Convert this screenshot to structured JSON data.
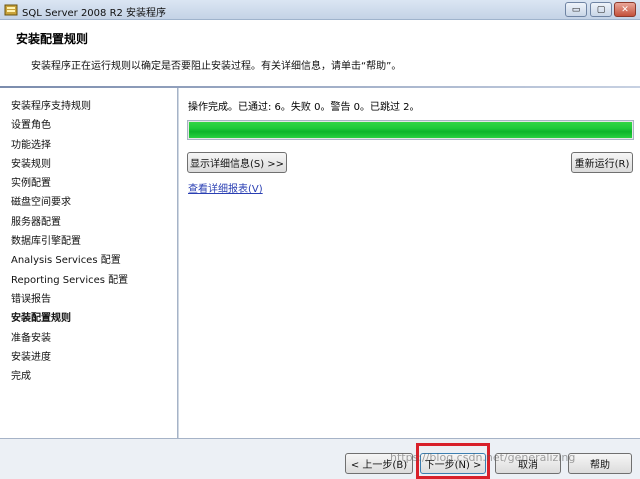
{
  "window": {
    "title": "SQL Server 2008 R2 安装程序",
    "controls": {
      "minimize": "▭",
      "maximize": "▢",
      "close": "✕"
    }
  },
  "header": {
    "title": "安装配置规则",
    "description": "安装程序正在运行规则以确定是否要阻止安装过程。有关详细信息，请单击“帮助”。"
  },
  "sidebar": {
    "items": [
      {
        "label": "安装程序支持规则"
      },
      {
        "label": "设置角色"
      },
      {
        "label": "功能选择"
      },
      {
        "label": "安装规则"
      },
      {
        "label": "实例配置"
      },
      {
        "label": "磁盘空间要求"
      },
      {
        "label": "服务器配置"
      },
      {
        "label": "数据库引擎配置"
      },
      {
        "label": "Analysis Services 配置"
      },
      {
        "label": "Reporting Services 配置"
      },
      {
        "label": "错误报告"
      },
      {
        "label": "安装配置规则",
        "active": true
      },
      {
        "label": "准备安装"
      },
      {
        "label": "安装进度"
      },
      {
        "label": "完成"
      }
    ]
  },
  "main": {
    "status": "操作完成。已通过: 6。失败 0。警告 0。已跳过 2。",
    "progress": 1.0,
    "show_details_label": "显示详细信息(S) >>",
    "rerun_label": "重新运行(R)",
    "report_link": "查看详细报表(V)"
  },
  "footer": {
    "back_label": "< 上一步(B)",
    "next_label": "下一步(N) >",
    "cancel_label": "取消",
    "help_label": "帮助"
  },
  "watermark": "https://blog.csdn.net/generalizing",
  "colors": {
    "progress": "#1fc93a",
    "highlight": "#d8202a",
    "link": "#2a3fb3"
  }
}
